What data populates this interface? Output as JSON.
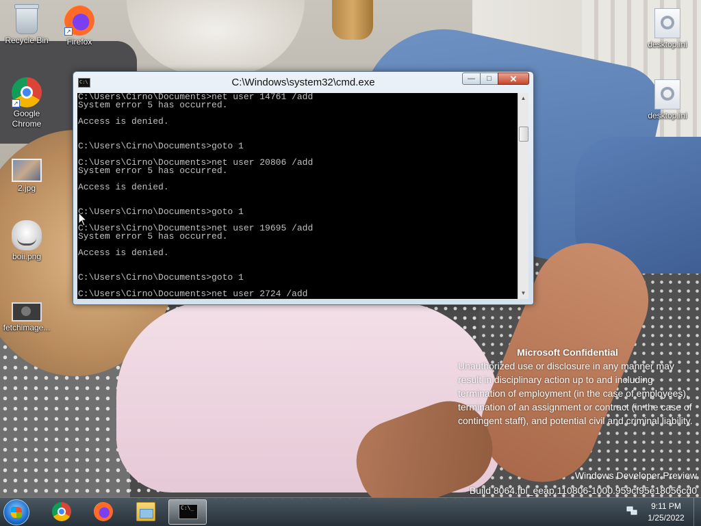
{
  "desktop": {
    "icons": [
      {
        "label": "Recycle Bin",
        "icon": "recycle-bin-icon"
      },
      {
        "label": "Firefox",
        "icon": "firefox-icon"
      },
      {
        "label": "Google Chrome",
        "icon": "chrome-icon"
      },
      {
        "label": "2.jpg",
        "icon": "image-file-icon"
      },
      {
        "label": "boii.png",
        "icon": "image-file-icon"
      },
      {
        "label": "fetchimage...",
        "icon": "image-file-icon"
      },
      {
        "label": "desktop.ini",
        "icon": "settings-file-icon"
      },
      {
        "label": "desktop.ini",
        "icon": "settings-file-icon"
      }
    ]
  },
  "cmd": {
    "title": "C:\\Windows\\system32\\cmd.exe",
    "icon_text": "C:\\",
    "buttons": {
      "minimize": "—",
      "maximize": "□",
      "close": "✕"
    },
    "lines": [
      "C:\\Users\\Cirno\\Documents>net user 14761 /add",
      "System error 5 has occurred.",
      "",
      "Access is denied.",
      "",
      "",
      "C:\\Users\\Cirno\\Documents>goto 1",
      "",
      "C:\\Users\\Cirno\\Documents>net user 20806 /add",
      "System error 5 has occurred.",
      "",
      "Access is denied.",
      "",
      "",
      "C:\\Users\\Cirno\\Documents>goto 1",
      "",
      "C:\\Users\\Cirno\\Documents>net user 19695 /add",
      "System error 5 has occurred.",
      "",
      "Access is denied.",
      "",
      "",
      "C:\\Users\\Cirno\\Documents>goto 1",
      "",
      "C:\\Users\\Cirno\\Documents>net user 2724 /add"
    ]
  },
  "watermark": {
    "heading": "Microsoft Confidential",
    "body": "Unauthorized use or disclosure in any manner may result in disciplinary action up to and including termination of employment (in the case of employees), termination of an assignment or contract (in the case of contingent staff), and potential civil and criminal liability.",
    "build_line1": "Windows Developer Preview",
    "build_line2": "Build 8064.fbl_eeap.110806-1000.959cf95e18056cd0"
  },
  "taskbar": {
    "pinned": [
      "chrome-icon",
      "firefox-icon",
      "file-explorer-icon",
      "cmd-icon"
    ],
    "cmd_icon_text": "C:\\_",
    "clock_time": "9:11 PM",
    "clock_date": "1/25/2022"
  },
  "colors": {
    "console_bg": "#000000",
    "console_text": "#c0c0c0",
    "close_button": "#c7472d"
  }
}
